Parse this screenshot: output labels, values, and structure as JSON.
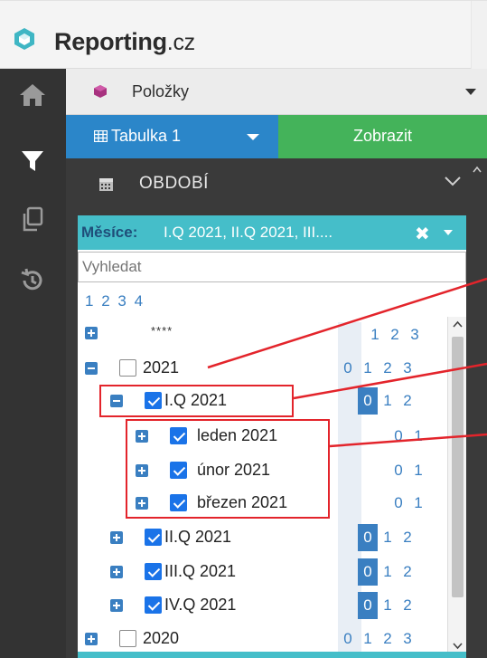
{
  "brand": {
    "name": "Reporting",
    "tld": ".cz",
    "accent": "#45bec9"
  },
  "rail": {
    "icons": [
      "home-icon",
      "filter-icon",
      "copy-icon",
      "history-icon"
    ]
  },
  "toolbar": {
    "polozky_label": "Položky",
    "tabulka_label": "Tabulka 1",
    "zobrazit_label": "Zobrazit"
  },
  "section": {
    "title": "OBDOBÍ"
  },
  "filter": {
    "key": "Měsíce:",
    "value": "I.Q 2021, II.Q 2021, III....",
    "clear_symbol": "✖",
    "search_placeholder": "Vyhledat",
    "levels": [
      "1",
      "2",
      "3",
      "4"
    ]
  },
  "tree": {
    "root": {
      "label": "****",
      "nums": [
        "1",
        "2",
        "3"
      ]
    },
    "year2021": {
      "label": "2021",
      "nums": [
        "0",
        "1",
        "2",
        "3"
      ]
    },
    "q1": {
      "label": "I.Q 2021",
      "nums": [
        "0",
        "1",
        "2"
      ]
    },
    "m1": {
      "label": "leden 2021",
      "nums": [
        "0",
        "1"
      ]
    },
    "m2": {
      "label": "únor 2021",
      "nums": [
        "0",
        "1"
      ]
    },
    "m3": {
      "label": "březen 2021",
      "nums": [
        "0",
        "1"
      ]
    },
    "q2": {
      "label": "II.Q 2021",
      "nums": [
        "0",
        "1",
        "2"
      ]
    },
    "q3": {
      "label": "III.Q 2021",
      "nums": [
        "0",
        "1",
        "2"
      ]
    },
    "q4": {
      "label": "IV.Q 2021",
      "nums": [
        "0",
        "1",
        "2"
      ]
    },
    "year2020": {
      "label": "2020",
      "nums": [
        "0",
        "1",
        "2",
        "3"
      ]
    }
  }
}
